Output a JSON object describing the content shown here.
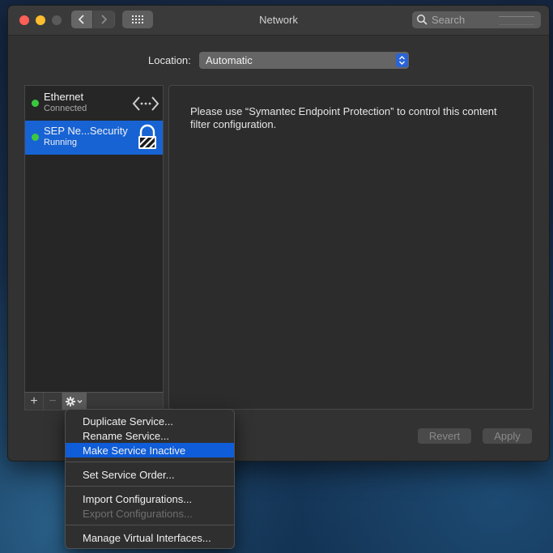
{
  "window": {
    "title": "Network",
    "search_placeholder": "Search",
    "location_label": "Location:",
    "location_value": "Automatic"
  },
  "services": [
    {
      "name": "Ethernet",
      "status": "Connected",
      "icon": "ethernet-arrows-icon",
      "status_color": "#3bc83e"
    },
    {
      "name": "SEP Ne...Security",
      "status": "Running",
      "icon": "lock-icon",
      "status_color": "#3bc83e",
      "selected": true
    }
  ],
  "toolbar": {
    "add": "+",
    "remove": "−"
  },
  "content": {
    "message": "Please use “Symantec Endpoint Protection” to control this content filter configuration."
  },
  "buttons": {
    "revert": "Revert",
    "apply": "Apply"
  },
  "menu": {
    "items": [
      {
        "label": "Duplicate Service...",
        "enabled": true
      },
      {
        "label": "Rename Service...",
        "enabled": true
      },
      {
        "label": "Make Service Inactive",
        "enabled": true,
        "highlighted": true
      },
      {
        "label": "Set Service Order...",
        "enabled": true
      },
      {
        "label": "Import Configurations...",
        "enabled": true
      },
      {
        "label": "Export Configurations...",
        "enabled": false
      },
      {
        "label": "Manage Virtual Interfaces...",
        "enabled": true
      }
    ]
  },
  "colors": {
    "accent": "#1763d4",
    "menu_highlight": "#0f5dd9",
    "status_green": "#3bc83e"
  }
}
